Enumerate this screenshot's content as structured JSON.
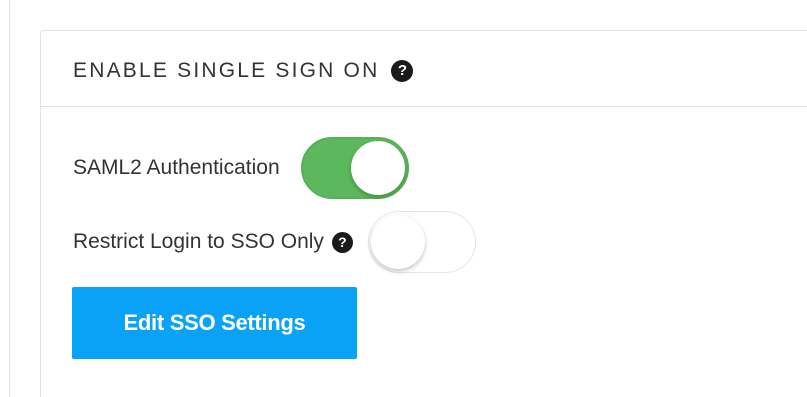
{
  "panel": {
    "title": "ENABLE SINGLE SIGN ON",
    "help_icon": "question-circle-icon"
  },
  "settings": {
    "saml2": {
      "label": "SAML2 Authentication",
      "enabled": true
    },
    "restrict_login": {
      "label": "Restrict Login to SSO Only",
      "help_icon": "question-circle-icon",
      "enabled": false
    }
  },
  "actions": {
    "edit_sso_label": "Edit SSO Settings"
  },
  "colors": {
    "toggle_on": "#5cb85c",
    "primary_button": "#0aa2f7",
    "text": "#333333"
  }
}
